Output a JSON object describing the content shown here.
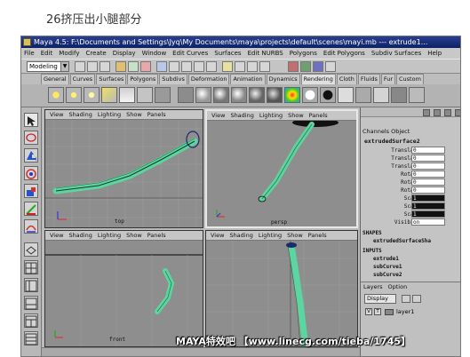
{
  "caption": "26挤压出小腿部分",
  "window": {
    "title": "Maya 4.5: F:\\Documents and Settings\\Jyq\\My Documents\\maya\\projects\\default\\scenes\\mayi.mb  ---  extrude1..."
  },
  "menubar": {
    "items": [
      "File",
      "Edit",
      "Modify",
      "Create",
      "Display",
      "Window",
      "Edit Curves",
      "Surfaces",
      "Edit NURBS",
      "Polygons",
      "Edit Polygons",
      "Subdiv Surfaces",
      "Help"
    ]
  },
  "toolbar": {
    "mode": "Modeling"
  },
  "shelf_tabs": [
    "General",
    "Curves",
    "Surfaces",
    "Polygons",
    "Subdivs",
    "Deformation",
    "Animation",
    "Dynamics",
    "Rendering",
    "Cloth",
    "Fluids",
    "Fur",
    "Custom"
  ],
  "shelf_active": "Rendering",
  "viewports": [
    {
      "menu": [
        "View",
        "Shading",
        "Lighting",
        "Show",
        "Panels"
      ],
      "label": "top"
    },
    {
      "menu": [
        "View",
        "Shading",
        "Lighting",
        "Show",
        "Panels"
      ],
      "label": "persp"
    },
    {
      "menu": [
        "View",
        "Shading",
        "Lighting",
        "Show",
        "Panels"
      ],
      "label": "front"
    },
    {
      "menu": [
        "View",
        "Shading",
        "Lighting",
        "Show",
        "Panels"
      ],
      "label": ""
    }
  ],
  "channel_box": {
    "header": "Channels  Object",
    "object_name": "extrudedSurface2",
    "attributes": [
      {
        "name": "Translate X",
        "value": "0"
      },
      {
        "name": "Translate Y",
        "value": "0"
      },
      {
        "name": "Translate Z",
        "value": "0"
      },
      {
        "name": "Rotate X",
        "value": "0"
      },
      {
        "name": "Rotate Y",
        "value": "0"
      },
      {
        "name": "Rotate Z",
        "value": "0"
      },
      {
        "name": "Scale X",
        "value": "1"
      },
      {
        "name": "Scale Y",
        "value": "1"
      },
      {
        "name": "Scale Z",
        "value": "1"
      },
      {
        "name": "Visibility",
        "value": "on"
      }
    ],
    "shapes_title": "SHAPES",
    "shape_name": "extrudedSurfaceSha",
    "inputs_title": "INPUTS",
    "inputs": [
      "extrude1",
      "subCurve1",
      "subCurve2"
    ]
  },
  "layers": {
    "menu": [
      "Layers",
      "Option"
    ],
    "display": "Display",
    "layer": {
      "v": "V",
      "t": "T",
      "name": "layer1"
    }
  },
  "watermark": "MAYA特效吧 【www.linecg.com/tieba/1745】"
}
